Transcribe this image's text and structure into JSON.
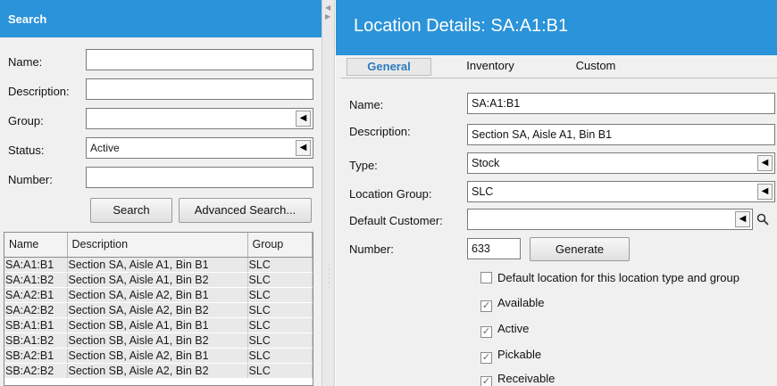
{
  "search_panel": {
    "title": "Search",
    "fields": {
      "name_label": "Name:",
      "name_value": "",
      "description_label": "Description:",
      "description_value": "",
      "group_label": "Group:",
      "group_value": "",
      "status_label": "Status:",
      "status_value": "Active",
      "number_label": "Number:",
      "number_value": ""
    },
    "search_button": "Search",
    "advanced_search_button": "Advanced Search...",
    "results": {
      "columns": [
        "Name",
        "Description",
        "Group"
      ],
      "rows": [
        [
          "SA:A1:B1",
          "Section SA, Aisle A1, Bin B1",
          "SLC"
        ],
        [
          "SA:A1:B2",
          "Section SA, Aisle A1, Bin B2",
          "SLC"
        ],
        [
          "SA:A2:B1",
          "Section SA, Aisle A2, Bin B1",
          "SLC"
        ],
        [
          "SA:A2:B2",
          "Section SA, Aisle A2, Bin B2",
          "SLC"
        ],
        [
          "SB:A1:B1",
          "Section SB, Aisle A1, Bin B1",
          "SLC"
        ],
        [
          "SB:A1:B2",
          "Section SB, Aisle A1, Bin B2",
          "SLC"
        ],
        [
          "SB:A2:B1",
          "Section SB, Aisle A2, Bin B1",
          "SLC"
        ],
        [
          "SB:A2:B2",
          "Section SB, Aisle A2, Bin B2",
          "SLC"
        ]
      ]
    }
  },
  "details_panel": {
    "title": "Location Details: SA:A1:B1",
    "tabs": [
      "General",
      "Inventory",
      "Custom"
    ],
    "active_tab": "General",
    "fields": {
      "name_label": "Name:",
      "name_value": "SA:A1:B1",
      "description_label": "Description:",
      "description_value": "Section SA, Aisle A1, Bin B1",
      "type_label": "Type:",
      "type_value": "Stock",
      "location_group_label": "Location Group:",
      "location_group_value": "SLC",
      "default_customer_label": "Default Customer:",
      "default_customer_value": "",
      "number_label": "Number:",
      "number_value": "633"
    },
    "generate_button": "Generate",
    "checkboxes": [
      {
        "label": "Default location for this location type and group",
        "checked": false
      },
      {
        "label": "Available",
        "checked": true
      },
      {
        "label": "Active",
        "checked": true
      },
      {
        "label": "Pickable",
        "checked": true
      },
      {
        "label": "Receivable",
        "checked": true
      }
    ]
  },
  "icons": {
    "dropdown": "dropdown-arrow-icon",
    "search": "magnifier-icon",
    "collapse": "collapse-arrow-icon"
  },
  "colors": {
    "header_blue": "#2b93d9",
    "active_tab_text": "#2b7bc0"
  }
}
